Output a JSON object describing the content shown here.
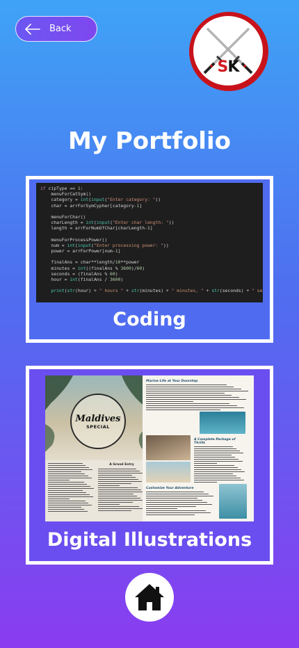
{
  "nav": {
    "back_label": "Back",
    "back_icon": "arrow-left-icon",
    "home_icon": "home-icon"
  },
  "logo": {
    "letter_s": "S",
    "letter_k": "K",
    "icon": "crossed-swords-icon"
  },
  "page": {
    "title": "My Portfolio"
  },
  "cards": [
    {
      "label": "Coding",
      "code_lines": [
        "if cipType == 1:",
        "    menuForCatSym()",
        "    category = int(input(\"Enter category: \"))",
        "    char = arrForSymCypher[category-1]",
        "",
        "    menuForChar()",
        "    charLength = int(input(\"Enter char length: \"))",
        "    length = arrForNumOfChar[charLength-1]",
        "",
        "    menuForProcessPower()",
        "    num = int(input(\"Enter processing power: \"))",
        "    power = arrForPower[num-1]",
        "",
        "    finalAns = char**length/10**power",
        "    minutes = int((finalAns % 3600)/60)",
        "    seconds = (finalAns % 60)",
        "    hour = int(finalAns / 3600)",
        "",
        "    print(str(hour) + \" hours \" + str(minutes) + \" minutes, \" + str(seconds) + \" seconds\")"
      ]
    },
    {
      "label": "Digital Illustrations",
      "magazine": {
        "badge_title": "Maldives",
        "badge_sub": "SPECIAL",
        "left_heading": "A Grand Entry",
        "right_section_1": "Marine Life at Your Doorstep",
        "right_section_2": "A Complete Package of Thrills",
        "right_section_3": "Customize Your Adventure"
      }
    }
  ],
  "colors": {
    "bg_top": "#3fa3f6",
    "bg_bottom": "#8a3cf0",
    "logo_red": "#c8121b",
    "code_bg": "#1e1e1e"
  }
}
